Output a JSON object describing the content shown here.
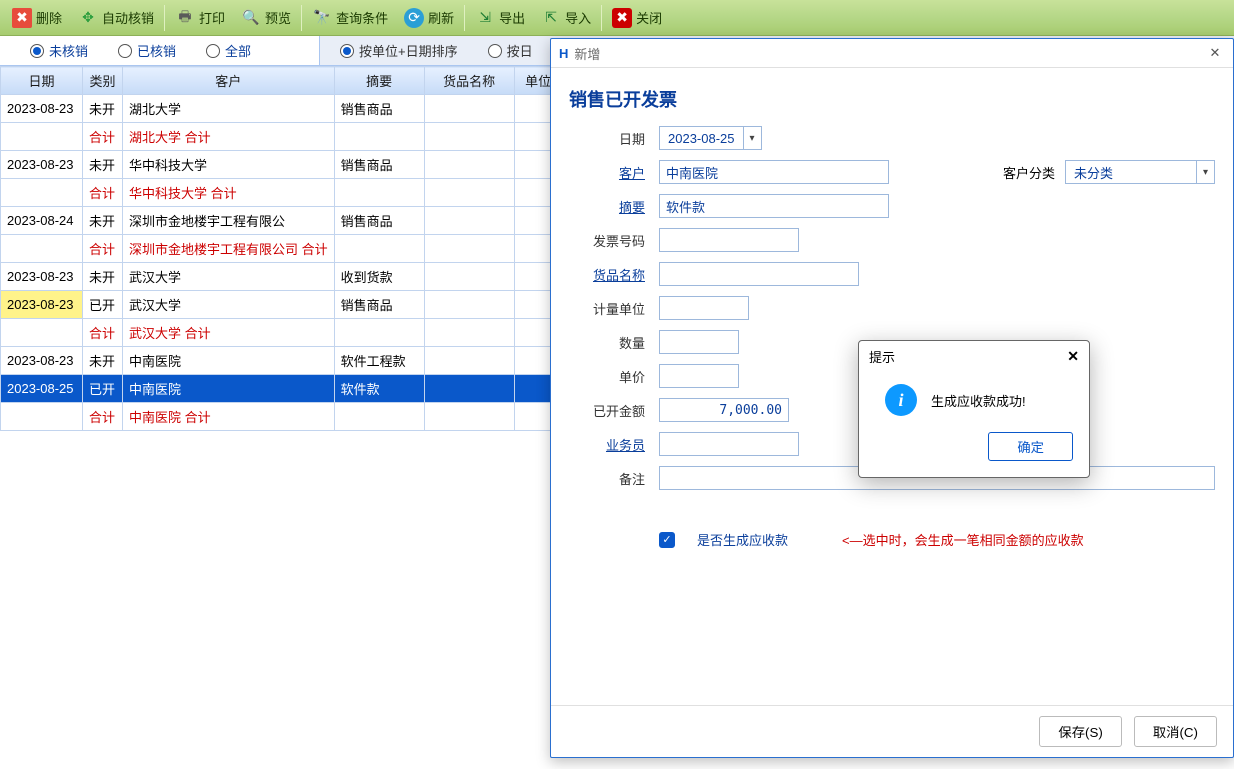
{
  "toolbar": {
    "delete": "删除",
    "auto_writeoff": "自动核销",
    "print": "打印",
    "preview": "预览",
    "query_cond": "查询条件",
    "refresh": "刷新",
    "export": "导出",
    "import": "导入",
    "close": "关闭"
  },
  "filters": {
    "not_written": "未核销",
    "written": "已核销",
    "all": "全部"
  },
  "sorts": {
    "by_unit_date": "按单位+日期排序",
    "by_date_partial": "按日"
  },
  "columns": {
    "date": "日期",
    "category": "类别",
    "customer": "客户",
    "summary": "摘要",
    "product": "货品名称",
    "unit": "单位"
  },
  "rows": [
    {
      "date": "2023-08-23",
      "cat": "未开",
      "cust": "湖北大学",
      "sum": "销售商品",
      "prod": "",
      "unit": ""
    },
    {
      "date": "",
      "cat": "合计",
      "catClass": "red",
      "cust": "湖北大学 合计",
      "custClass": "red",
      "sum": "",
      "prod": "",
      "unit": ""
    },
    {
      "date": "2023-08-23",
      "cat": "未开",
      "cust": "华中科技大学",
      "sum": "销售商品",
      "prod": "",
      "unit": ""
    },
    {
      "date": "",
      "cat": "合计",
      "catClass": "red",
      "cust": "华中科技大学 合计",
      "custClass": "red",
      "sum": "",
      "prod": "",
      "unit": ""
    },
    {
      "date": "2023-08-24",
      "cat": "未开",
      "cust": "深圳市金地楼宇工程有限公",
      "sum": "销售商品",
      "prod": "",
      "unit": ""
    },
    {
      "date": "",
      "cat": "合计",
      "catClass": "red",
      "cust": "深圳市金地楼宇工程有限公司 合计",
      "custClass": "red",
      "sum": "",
      "prod": "",
      "unit": ""
    },
    {
      "date": "2023-08-23",
      "cat": "未开",
      "cust": "武汉大学",
      "sum": "收到货款",
      "prod": "",
      "unit": ""
    },
    {
      "date": "2023-08-23",
      "cat": "已开",
      "cust": "武汉大学",
      "sum": "销售商品",
      "prod": "",
      "unit": "",
      "rowClass": "yellow-date"
    },
    {
      "date": "",
      "cat": "合计",
      "catClass": "red",
      "cust": "武汉大学 合计",
      "custClass": "red",
      "sum": "",
      "prod": "",
      "unit": ""
    },
    {
      "date": "2023-08-23",
      "cat": "未开",
      "cust": "中南医院",
      "sum": "软件工程款",
      "prod": "",
      "unit": ""
    },
    {
      "date": "2023-08-25",
      "cat": "已开",
      "cust": "中南医院",
      "sum": "软件款",
      "prod": "",
      "unit": "",
      "rowClass": "sel"
    },
    {
      "date": "",
      "cat": "合计",
      "catClass": "red",
      "cust": "中南医院 合计",
      "custClass": "red",
      "sum": "",
      "prod": "",
      "unit": ""
    }
  ],
  "dialog": {
    "window_title": "新增",
    "title": "销售已开发票",
    "labels": {
      "date": "日期",
      "customer": "客户",
      "customer_cat": "客户分类",
      "summary": "摘要",
      "invoice_no": "发票号码",
      "product": "货品名称",
      "unit": "计量单位",
      "qty": "数量",
      "price": "单价",
      "amount": "已开金额",
      "sales": "业务员",
      "remark": "备注",
      "gen_receivable": "是否生成应收款",
      "gen_hint": "<—选中时，会生成一笔相同金额的应收款"
    },
    "values": {
      "date": "2023-08-25",
      "customer": "中南医院",
      "customer_cat": "未分类",
      "summary": "软件款",
      "invoice_no": "",
      "product": "",
      "unit": "",
      "qty": "",
      "price": "",
      "amount": "7,000.00",
      "sales": "",
      "remark": ""
    },
    "buttons": {
      "save": "保存(S)",
      "cancel": "取消(C)"
    }
  },
  "prompt": {
    "title": "提示",
    "message": "生成应收款成功!",
    "ok": "确定"
  }
}
